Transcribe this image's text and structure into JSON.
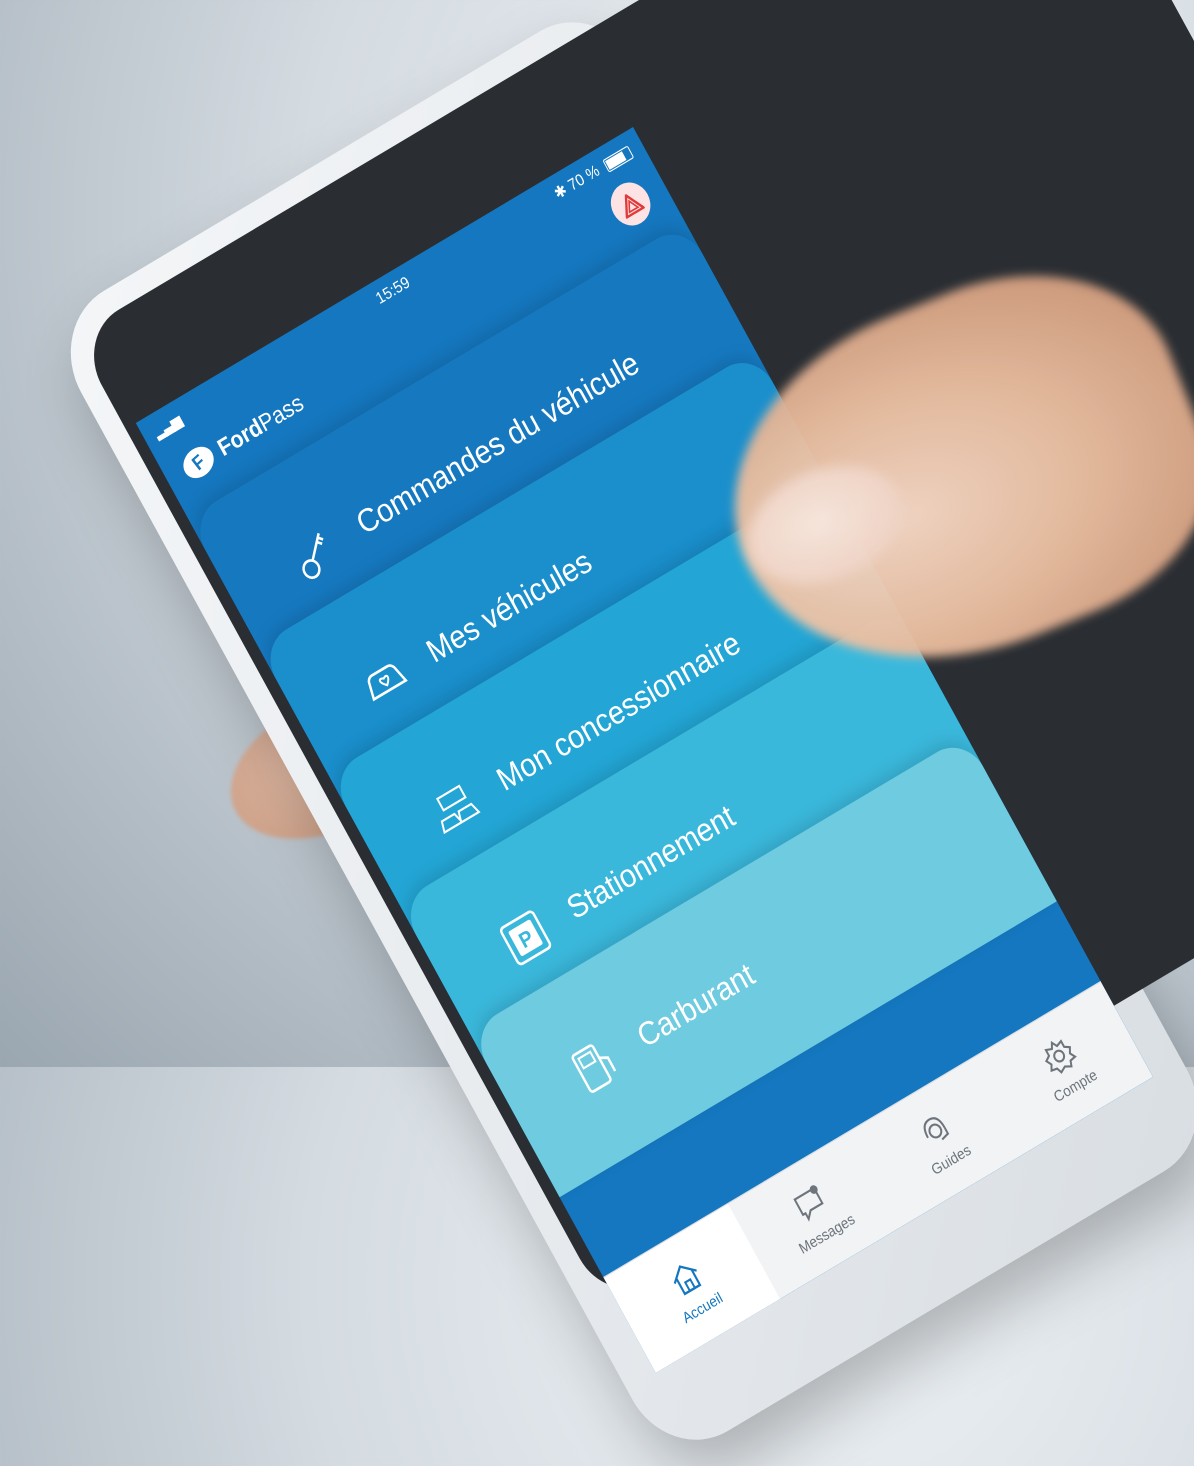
{
  "status": {
    "time": "15:59",
    "battery": "70 %"
  },
  "app": {
    "brand_bold": "Ford",
    "brand_light": "Pass"
  },
  "menu": [
    {
      "label": "Commandes du véhicule",
      "icon": "key-icon",
      "color": "#1679c0"
    },
    {
      "label": "Mes véhicules",
      "icon": "car-heart-icon",
      "color": "#1a8fcc"
    },
    {
      "label": "Mon concessionnaire",
      "icon": "dealer-cars-icon",
      "color": "#23a6d5"
    },
    {
      "label": "Stationnement",
      "icon": "parking-icon",
      "color": "#3ab8dc"
    },
    {
      "label": "Carburant",
      "icon": "fuel-pump-icon",
      "color": "#6fcbe0"
    }
  ],
  "tabs": [
    {
      "label": "Accueil",
      "icon": "home-icon",
      "active": true
    },
    {
      "label": "Messages",
      "icon": "message-icon",
      "active": false
    },
    {
      "label": "Guides",
      "icon": "headset-icon",
      "active": false
    },
    {
      "label": "Compte",
      "icon": "gear-icon",
      "active": false
    }
  ]
}
